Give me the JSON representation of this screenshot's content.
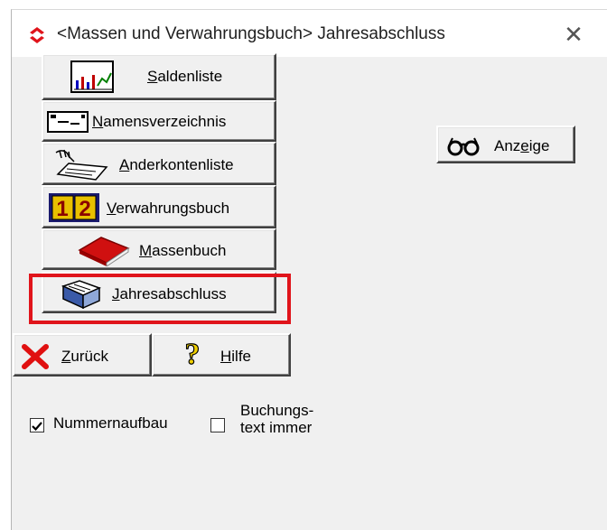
{
  "window": {
    "title": "<Massen und Verwahrungsbuch> Jahresabschluss",
    "close_glyph": "✕"
  },
  "nav": {
    "saldenliste": {
      "mn": "S",
      "rest": "aldenliste"
    },
    "namensverzeichnis": {
      "mn": "N",
      "rest": "amensverzeichnis"
    },
    "anderkontenliste": {
      "mn": "A",
      "rest": "nderkontenliste"
    },
    "verwahrungsbuch": {
      "mn": "V",
      "rest": "erwahrungsbuch"
    },
    "massenbuch": {
      "mn": "M",
      "rest": "assenbuch"
    },
    "jahresabschluss": {
      "mn": "J",
      "rest": "ahresabschluss"
    }
  },
  "actions": {
    "zurueck": {
      "mn": "Z",
      "rest": "urück"
    },
    "hilfe": {
      "mn": "H",
      "rest": "ilfe"
    },
    "anzeige": {
      "pre": "Anz",
      "mn": "e",
      "rest": "ige"
    }
  },
  "options": {
    "nummernaufbau": {
      "label": "Nummernaufbau",
      "checked": true
    },
    "buchungstext": {
      "line1": "Buchungs-",
      "line2": "text immer",
      "checked": false
    }
  },
  "icons": {
    "app": "app-logo-icon",
    "saldenliste": "chart-icon",
    "namensverzeichnis": "card-icon",
    "anderkontenliste": "hand-document-icon",
    "verwahrungsbuch": "number-12-icon",
    "massenbuch": "red-book-icon",
    "jahresabschluss": "open-book-icon",
    "zurueck": "red-x-icon",
    "hilfe": "question-icon",
    "anzeige": "glasses-icon"
  }
}
